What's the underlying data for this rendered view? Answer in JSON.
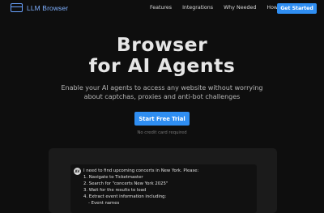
{
  "nav": {
    "logo_text": "LLM Browser",
    "links": [
      "Features",
      "Integrations",
      "Why Needed",
      "How It Works"
    ],
    "cta_label": "Get Started"
  },
  "hero": {
    "title_line1": "Browser",
    "title_line2": "for AI Agents",
    "subtitle": "Enable your AI agents to access any website without worrying about captchas, proxies and anti-bot challenges",
    "cta_label": "Start Free Trial",
    "note": "No credit card required"
  },
  "demo": {
    "avatar_initials": "AV",
    "message_lines": [
      "I need to find upcoming concerts in New York. Please:",
      "1. Navigate to Ticketmaster",
      "2. Search for \"concerts New York 2025\"",
      "3. Wait for the results to load",
      "4. Extract event information including:",
      "- Event names"
    ]
  },
  "colors": {
    "accent": "#2f8ef2",
    "logo": "#7fb0ff",
    "background": "#0e0e0e"
  }
}
